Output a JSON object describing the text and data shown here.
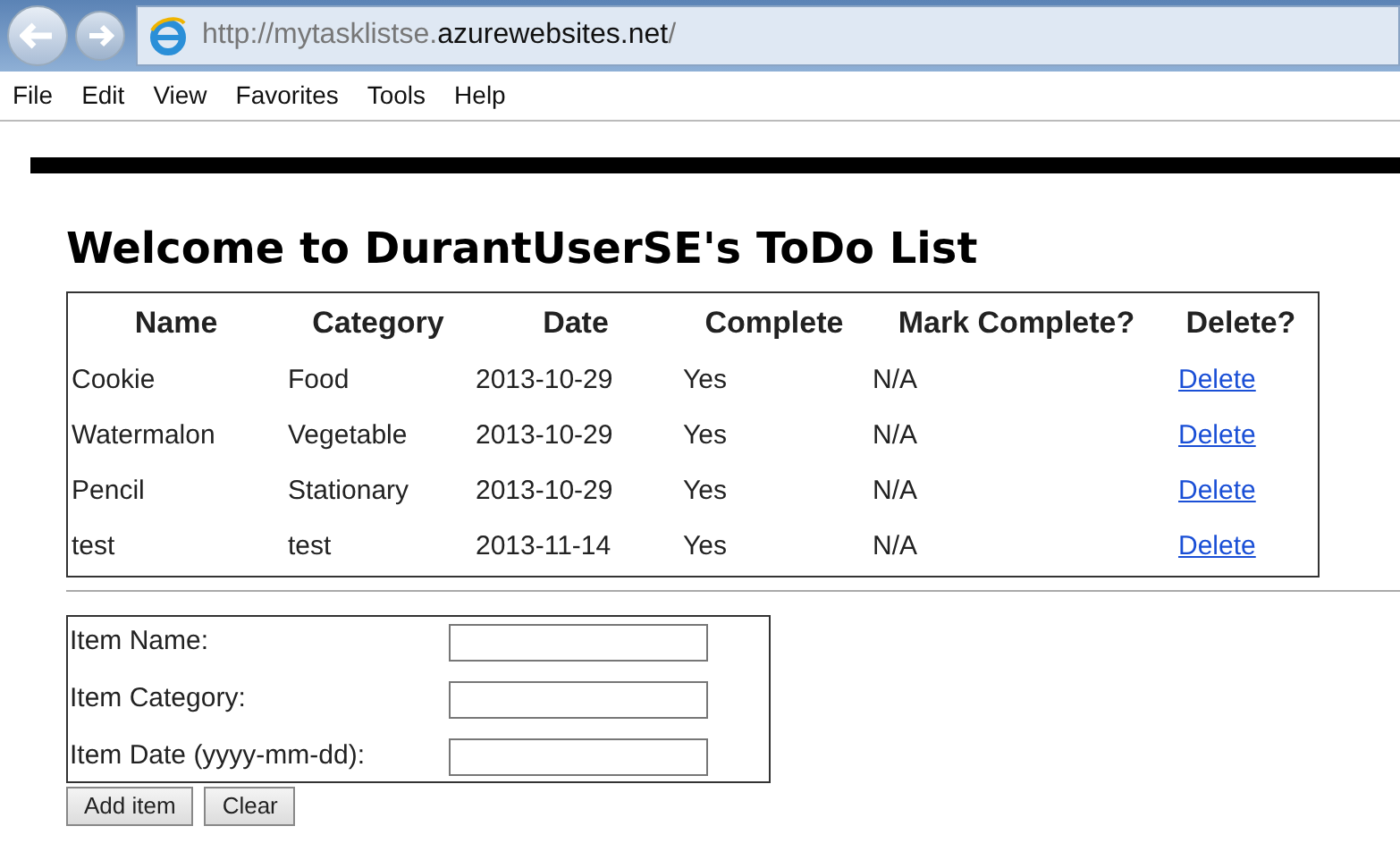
{
  "address_bar": {
    "url_prefix": "http://mytasklistse.",
    "url_domain": "azurewebsites.net",
    "url_suffix": "/"
  },
  "menu_bar": [
    "File",
    "Edit",
    "View",
    "Favorites",
    "Tools",
    "Help"
  ],
  "heading": "Welcome to DurantUserSE's ToDo List",
  "table": {
    "columns": [
      "Name",
      "Category",
      "Date",
      "Complete",
      "Mark Complete?",
      "Delete?"
    ],
    "rows": [
      {
        "name": "Cookie",
        "category": "Food",
        "date": "2013-10-29",
        "complete": "Yes",
        "mark_complete": "N/A",
        "delete": "Delete"
      },
      {
        "name": "Watermalon",
        "category": "Vegetable",
        "date": "2013-10-29",
        "complete": "Yes",
        "mark_complete": "N/A",
        "delete": "Delete"
      },
      {
        "name": "Pencil",
        "category": "Stationary",
        "date": "2013-10-29",
        "complete": "Yes",
        "mark_complete": "N/A",
        "delete": "Delete"
      },
      {
        "name": "test",
        "category": "test",
        "date": "2013-11-14",
        "complete": "Yes",
        "mark_complete": "N/A",
        "delete": "Delete"
      }
    ]
  },
  "form": {
    "fields": [
      {
        "label": "Item Name:"
      },
      {
        "label": "Item Category:"
      },
      {
        "label": "Item Date (yyyy-mm-dd):"
      }
    ],
    "buttons": [
      "Add item",
      "Clear"
    ]
  }
}
